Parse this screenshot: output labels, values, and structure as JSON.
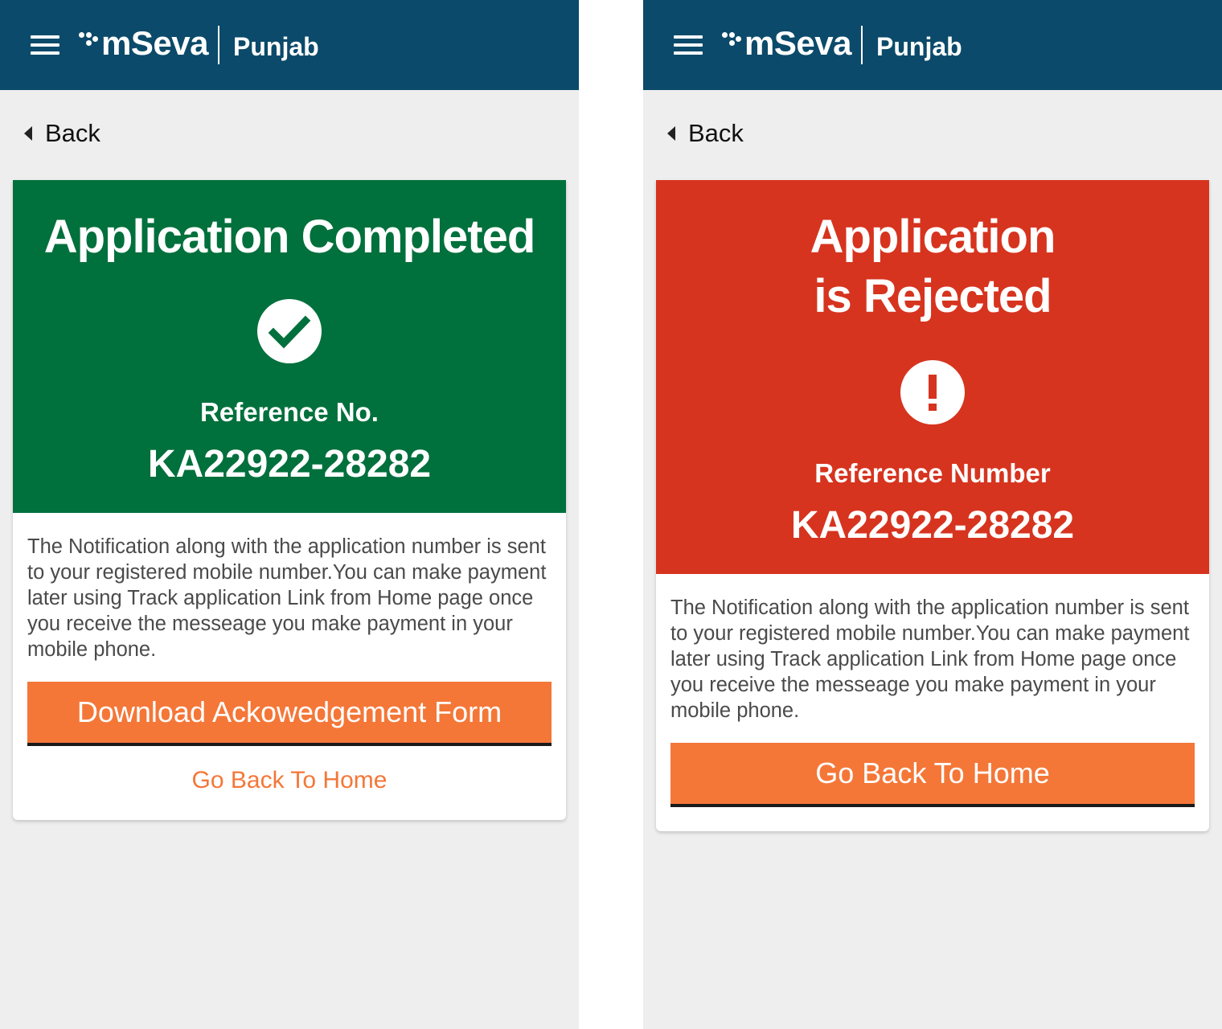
{
  "left": {
    "header": {
      "brand": "mSeva",
      "region": "Punjab"
    },
    "back_label": "Back",
    "banner": {
      "title": "Application Completed",
      "ref_label": "Reference No.",
      "ref_number": "KA22922-28282",
      "color": "#00703c",
      "icon": "check-circle-icon"
    },
    "message": "The Notification along with the application number is sent to your registered mobile number.You can make payment later using Track application Link from  Home page once you receive the messeage you make payment in your mobile phone.",
    "primary_button": "Download Ackowedgement Form",
    "secondary_link": "Go Back To Home"
  },
  "right": {
    "header": {
      "brand": "mSeva",
      "region": "Punjab"
    },
    "back_label": "Back",
    "banner": {
      "title": "Application\nis Rejected",
      "ref_label": "Reference Number",
      "ref_number": "KA22922-28282",
      "color": "#d6341f",
      "icon": "exclamation-circle-icon"
    },
    "message": "The Notification along with the application number is sent to your registered mobile number.You can make payment later using Track application Link from  Home page once you receive the messeage you make payment in your mobile phone.",
    "primary_button": "Go Back To Home"
  },
  "colors": {
    "header": "#0b4a6a",
    "accent": "#f47738",
    "background": "#eeeeee"
  }
}
